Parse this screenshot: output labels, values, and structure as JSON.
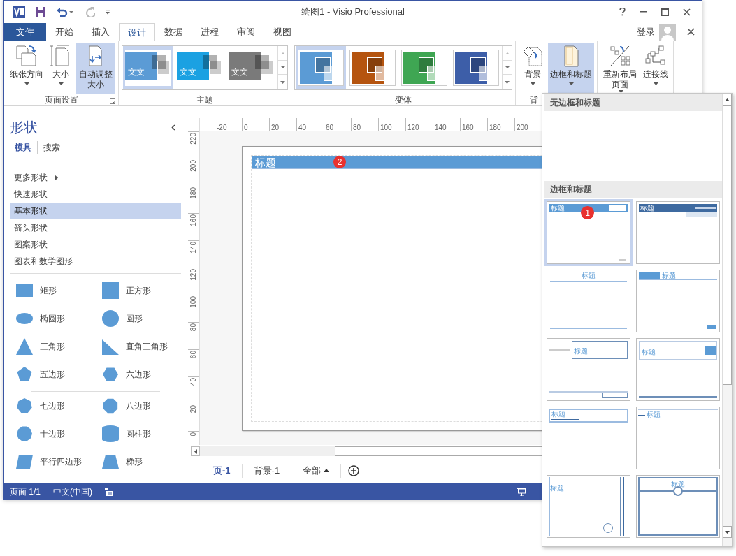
{
  "window": {
    "title": "绘图1 - Visio Professional"
  },
  "quick_access": [
    {
      "kind": "logo",
      "disabled": false
    },
    {
      "kind": "save",
      "disabled": false
    },
    {
      "kind": "undo",
      "disabled": false
    },
    {
      "kind": "redo",
      "disabled": true
    },
    {
      "kind": "customize",
      "disabled": false
    }
  ],
  "ribbon_tabs": [
    {
      "label": "文件",
      "kind": "file",
      "selected": false
    },
    {
      "label": "开始",
      "kind": "tab",
      "selected": false
    },
    {
      "label": "插入",
      "kind": "tab",
      "selected": false
    },
    {
      "label": "设计",
      "kind": "tab",
      "selected": true
    },
    {
      "label": "数据",
      "kind": "tab",
      "selected": false
    },
    {
      "label": "进程",
      "kind": "tab",
      "selected": false
    },
    {
      "label": "审阅",
      "kind": "tab",
      "selected": false
    },
    {
      "label": "视图",
      "kind": "tab",
      "selected": false
    }
  ],
  "account": {
    "sign_in": "登录"
  },
  "ribbon_groups": [
    {
      "kind": "buttons",
      "label": "页面设置",
      "launcher": true,
      "buttons": [
        {
          "label": "纸张方向",
          "kind": "orientation",
          "selected": false,
          "dropdown": true
        },
        {
          "label": "大小",
          "kind": "size",
          "selected": false,
          "dropdown": true
        },
        {
          "label": "自动调整大小",
          "kind": "autosize",
          "selected": true,
          "dropdown": false
        }
      ]
    },
    {
      "kind": "theme-gallery",
      "label": "主题",
      "items": [
        {
          "text": "文文",
          "color": "#5b9bd5",
          "selected": true
        },
        {
          "text": "文文",
          "color": "#1ba1e2",
          "selected": false
        },
        {
          "text": "文文",
          "color": "#7a7a7a",
          "selected": false
        }
      ]
    },
    {
      "kind": "variant-gallery",
      "label": "变体",
      "items": [
        {
          "color": "#5b9bd5",
          "selected": true
        },
        {
          "color": "#b5540f",
          "selected": false
        },
        {
          "color": "#3fa653",
          "selected": false
        },
        {
          "color": "#3d5ea8",
          "selected": false
        }
      ]
    },
    {
      "kind": "buttons",
      "label": "背",
      "buttons": [
        {
          "label": "背景",
          "kind": "background",
          "selected": false,
          "dropdown": true
        },
        {
          "label": "边框和标题",
          "kind": "borders",
          "selected": true,
          "dropdown": true
        }
      ]
    },
    {
      "kind": "buttons",
      "buttons": [
        {
          "label": "重新布局页面",
          "kind": "relayout",
          "selected": false,
          "dropdown": true
        },
        {
          "label": "连接线",
          "kind": "connectors",
          "selected": false,
          "dropdown": true
        }
      ]
    }
  ],
  "shapes_panel": {
    "title": "形状",
    "tabs": [
      {
        "label": "模具",
        "selected": true
      },
      {
        "label": "搜索",
        "selected": false
      }
    ],
    "stencils": [
      {
        "label": "更多形状",
        "kind": "submenu",
        "selected": false
      },
      {
        "label": "快速形状",
        "kind": "item",
        "selected": false
      },
      {
        "label": "基本形状",
        "kind": "item",
        "selected": true
      },
      {
        "label": "箭头形状",
        "kind": "item",
        "selected": false
      },
      {
        "label": "图案形状",
        "kind": "item",
        "selected": false
      },
      {
        "label": "图表和数学图形",
        "kind": "item",
        "selected": false
      }
    ],
    "shape_groups": [
      {
        "shapes": [
          {
            "label": "矩形",
            "kind": "rectangle"
          },
          {
            "label": "正方形",
            "kind": "square"
          },
          {
            "label": "椭圆形",
            "kind": "ellipse"
          },
          {
            "label": "圆形",
            "kind": "circle"
          },
          {
            "label": "三角形",
            "kind": "triangle"
          },
          {
            "label": "直角三角形",
            "kind": "right-triangle"
          },
          {
            "label": "五边形",
            "kind": "pentagon"
          },
          {
            "label": "六边形",
            "kind": "hexagon"
          }
        ]
      },
      {
        "shapes": [
          {
            "label": "七边形",
            "kind": "heptagon"
          },
          {
            "label": "八边形",
            "kind": "octagon"
          },
          {
            "label": "十边形",
            "kind": "decagon"
          },
          {
            "label": "圆柱形",
            "kind": "cylinder"
          },
          {
            "label": "平行四边形",
            "kind": "parallelogram"
          },
          {
            "label": "梯形",
            "kind": "trapezoid"
          }
        ]
      }
    ]
  },
  "rulers": {
    "horizontal": [
      "-20",
      "0",
      "20",
      "40",
      "60",
      "80",
      "100",
      "120",
      "140",
      "160",
      "180",
      "200"
    ],
    "vertical": [
      "220",
      "200",
      "180",
      "160",
      "140",
      "120",
      "100",
      "80",
      "60",
      "40",
      "20",
      "0"
    ]
  },
  "drawing_page": {
    "title": "标题",
    "badge": "2"
  },
  "page_tabs": [
    {
      "label": "页-1",
      "kind": "page",
      "selected": true
    },
    {
      "label": "背景-1",
      "kind": "page",
      "selected": false
    },
    {
      "label": "全部",
      "kind": "menu",
      "selected": false
    },
    {
      "kind": "add",
      "selected": false
    }
  ],
  "status_bar": {
    "page": "页面 1/1",
    "language": "中文(中国)"
  },
  "borders_menu": {
    "sections": [
      {
        "heading": "无边框和标题",
        "items": [
          {
            "kind": "blank",
            "selected": false
          }
        ]
      },
      {
        "heading": "边框和标题",
        "items": [
          {
            "kind": "banner",
            "title": "标题",
            "selected": true,
            "badge": "1"
          },
          {
            "kind": "dark-banner",
            "title": "标题",
            "selected": false
          },
          {
            "kind": "centered",
            "title": "标题",
            "selected": false
          },
          {
            "kind": "tag-left",
            "title": "标题",
            "selected": false
          },
          {
            "kind": "boxed",
            "title": "标题",
            "selected": false
          },
          {
            "kind": "boxed-accent",
            "title": "标题",
            "selected": false
          },
          {
            "kind": "boxed-subtitle",
            "title": "标题",
            "selected": false
          },
          {
            "kind": "rule-left",
            "title": "标题",
            "selected": false
          },
          {
            "kind": "side-bars",
            "title": "标题",
            "selected": false
          },
          {
            "kind": "circle",
            "title": "标题",
            "selected": false
          }
        ]
      }
    ]
  }
}
